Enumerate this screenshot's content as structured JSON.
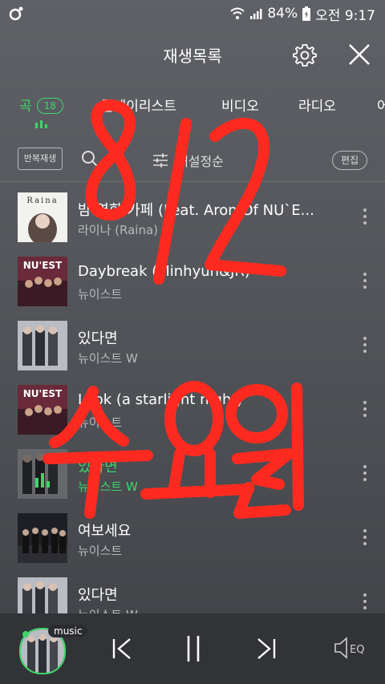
{
  "status_bar": {
    "battery": "84%",
    "time": "오전 9:17"
  },
  "header": {
    "title": "재생목록"
  },
  "tabs": [
    {
      "label": "곡",
      "count": "18"
    },
    {
      "label": "플레이리스트"
    },
    {
      "label": "비디오"
    },
    {
      "label": "라디오"
    },
    {
      "label": "어"
    }
  ],
  "toolbar": {
    "repeat_label": "반복재생",
    "sort_label": "내설정순",
    "edit_label": "편집"
  },
  "songs": [
    {
      "title": "밤 영화 카페 (Feat. Aron Of NU`E...",
      "artist": "라이나 (Raina)",
      "cover_text": "Raina"
    },
    {
      "title": "Daybreak (Minhyun&JR)",
      "artist": "뉴이스트",
      "cover_text": "NU'EST"
    },
    {
      "title": "있다면",
      "artist": "뉴이스트 W"
    },
    {
      "title": "Look (a starlight night)",
      "artist": "뉴이스트",
      "cover_text": "NU'EST"
    },
    {
      "title": "있다면",
      "artist": "뉴이스트 W"
    },
    {
      "title": "여보세요",
      "artist": "뉴이스트"
    },
    {
      "title": "있다면",
      "artist": "뉴이스트 W"
    }
  ],
  "player": {
    "label": "music"
  },
  "colors": {
    "accent": "#3fd56a",
    "annotation": "#ff2a1f"
  },
  "annotation": {
    "date": "8/2",
    "day": "수요일"
  }
}
